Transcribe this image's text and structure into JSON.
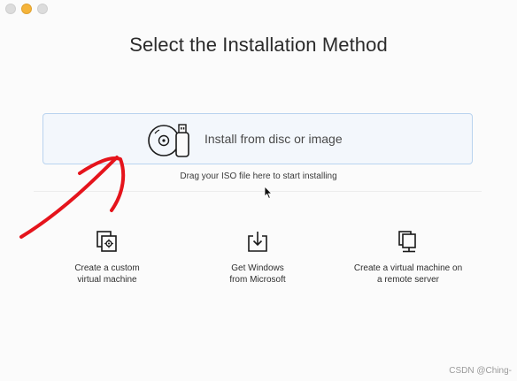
{
  "window": {
    "title": "Select the Installation Method",
    "traffic_lights": [
      "close",
      "minimize",
      "maximize"
    ]
  },
  "install": {
    "label": "Install from disc or image",
    "icon": "disc-usb-icon",
    "drag_hint": "Drag your ISO file here to start installing"
  },
  "options": [
    {
      "label": "Create a custom\nvirtual machine",
      "icon": "custom-vm-icon"
    },
    {
      "label": "Get Windows\nfrom Microsoft",
      "icon": "download-icon"
    },
    {
      "label": "Create a virtual machine on\na remote server",
      "icon": "remote-server-icon"
    }
  ],
  "watermark": "CSDN @Ching-",
  "colors": {
    "accent_border": "#b9d3ef",
    "install_bg": "#f3f7fc",
    "annotation_red": "#e5141c",
    "minimize_light": "#f5b43a"
  }
}
